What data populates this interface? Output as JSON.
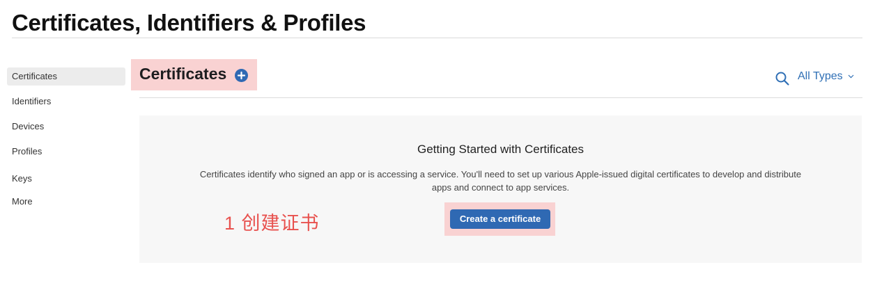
{
  "page": {
    "title": "Certificates, Identifiers & Profiles"
  },
  "sidebar": {
    "items": [
      {
        "label": "Certificates",
        "active": true
      },
      {
        "label": "Identifiers",
        "active": false
      },
      {
        "label": "Devices",
        "active": false
      },
      {
        "label": "Profiles",
        "active": false
      },
      {
        "label": "Keys",
        "active": false
      },
      {
        "label": "More",
        "active": false
      }
    ]
  },
  "section": {
    "title": "Certificates",
    "add_icon": "plus-circle-icon"
  },
  "toolbar": {
    "search_icon": "search-icon",
    "filter_label": "All Types",
    "filter_icon": "chevron-down-icon"
  },
  "empty_state": {
    "heading": "Getting Started with Certificates",
    "description": "Certificates identify who signed an app or is accessing a service. You'll need to set up various Apple-issued digital certificates to develop and distribute apps and connect to app services.",
    "button_label": "Create a certificate"
  },
  "annotation": {
    "text": "1 创建证书",
    "color": "#e8514e",
    "highlight_color": "#f9d2d2"
  },
  "colors": {
    "accent": "#2f69b3",
    "link": "#2f6fb5"
  }
}
